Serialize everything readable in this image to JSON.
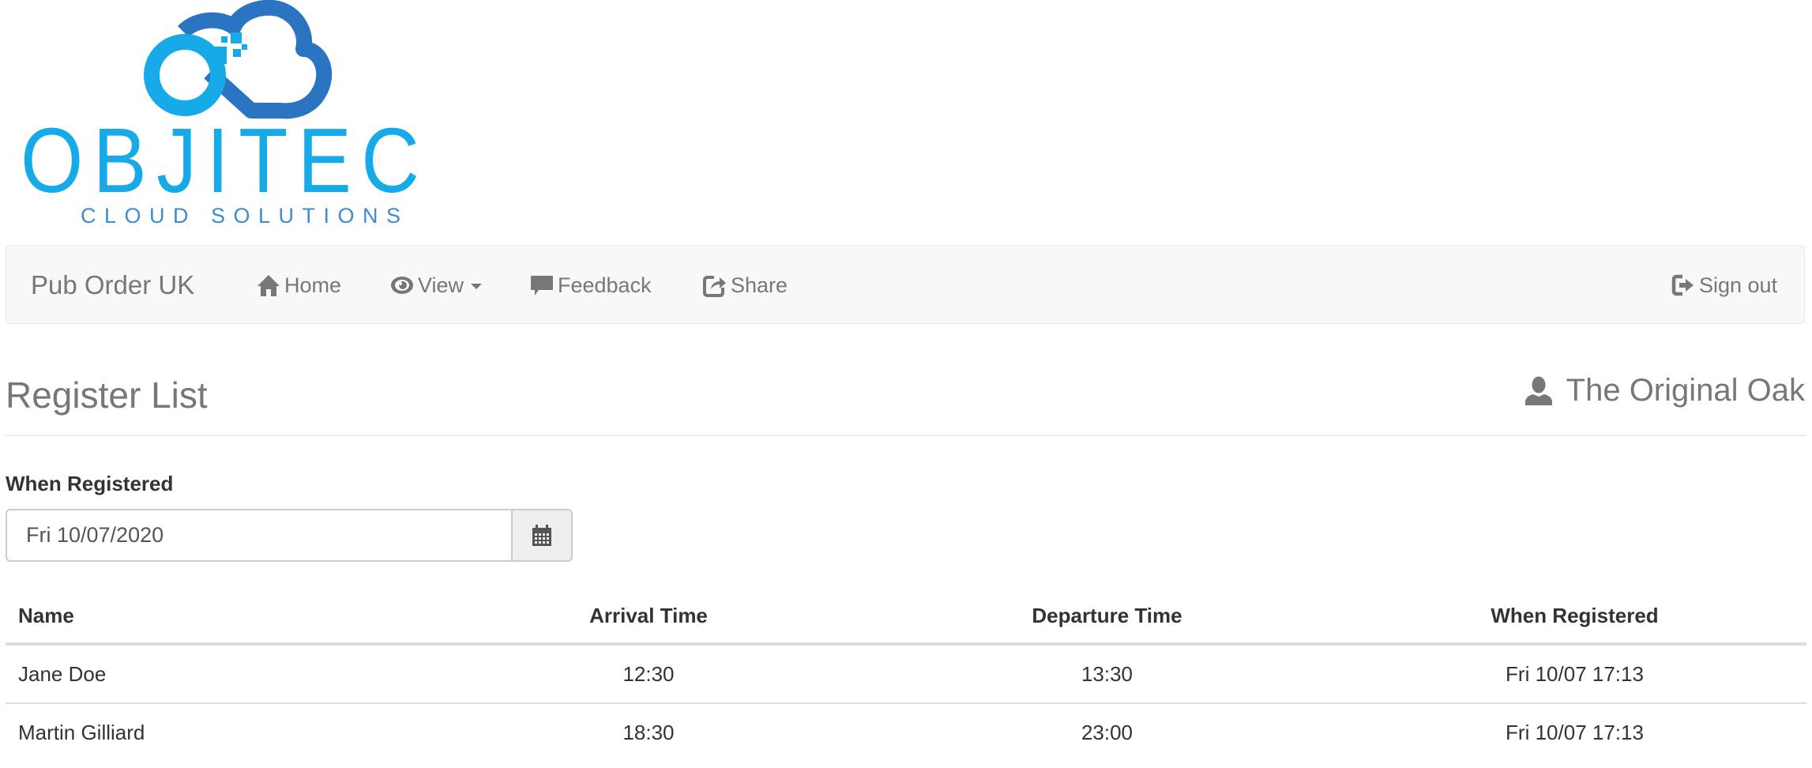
{
  "logo": {
    "wordmark": "OBJITEC",
    "tagline": "CLOUD SOLUTIONS",
    "colors": {
      "light_blue": "#17aae9",
      "dark_blue": "#2b74c1",
      "tagline": "#3f8bd0"
    }
  },
  "navbar": {
    "brand": "Pub Order UK",
    "items": [
      {
        "label": "Home",
        "icon": "home-icon"
      },
      {
        "label": "View",
        "icon": "eye-icon",
        "dropdown": true
      },
      {
        "label": "Feedback",
        "icon": "comment-icon"
      },
      {
        "label": "Share",
        "icon": "share-icon"
      }
    ],
    "sign_out": {
      "label": "Sign out",
      "icon": "sign-out-icon"
    }
  },
  "page": {
    "title": "Register List",
    "venue": {
      "name": "The Original Oak",
      "icon": "user-icon"
    }
  },
  "filter": {
    "label": "When Registered",
    "value": "Fri 10/07/2020",
    "icon": "calendar-icon"
  },
  "table": {
    "columns": [
      "Name",
      "Arrival Time",
      "Departure Time",
      "When Registered"
    ],
    "rows": [
      {
        "name": "Jane Doe",
        "arrival": "12:30",
        "departure": "13:30",
        "registered": "Fri 10/07 17:13"
      },
      {
        "name": "Martin Gilliard",
        "arrival": "18:30",
        "departure": "23:00",
        "registered": "Fri 10/07 17:13"
      }
    ]
  },
  "colors": {
    "navbar_bg": "#f8f8f8",
    "navbar_text": "#777777",
    "text": "#333333",
    "border": "#dddddd"
  }
}
